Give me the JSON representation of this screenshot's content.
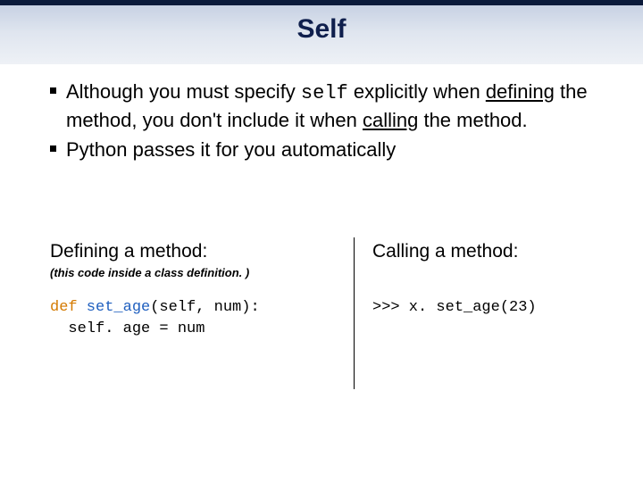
{
  "title": "Self",
  "bullets": {
    "b1_part1": "Although you must specify ",
    "b1_code": "self",
    "b1_part2": " explicitly when ",
    "b1_defining": "defining",
    "b1_part3": " the method, you don't include it when ",
    "b1_calling": "calling",
    "b1_part4": " the method.",
    "b2": "Python passes it for you automatically"
  },
  "left": {
    "heading": "Defining a method:",
    "note": "(this code inside a class definition. )",
    "code_kw": "def",
    "code_fn": " set_age",
    "code_rest1": "(self, num):",
    "code_line2": "  self. age = num"
  },
  "right": {
    "heading": "Calling a method:",
    "code": ">>> x. set_age(23)"
  }
}
